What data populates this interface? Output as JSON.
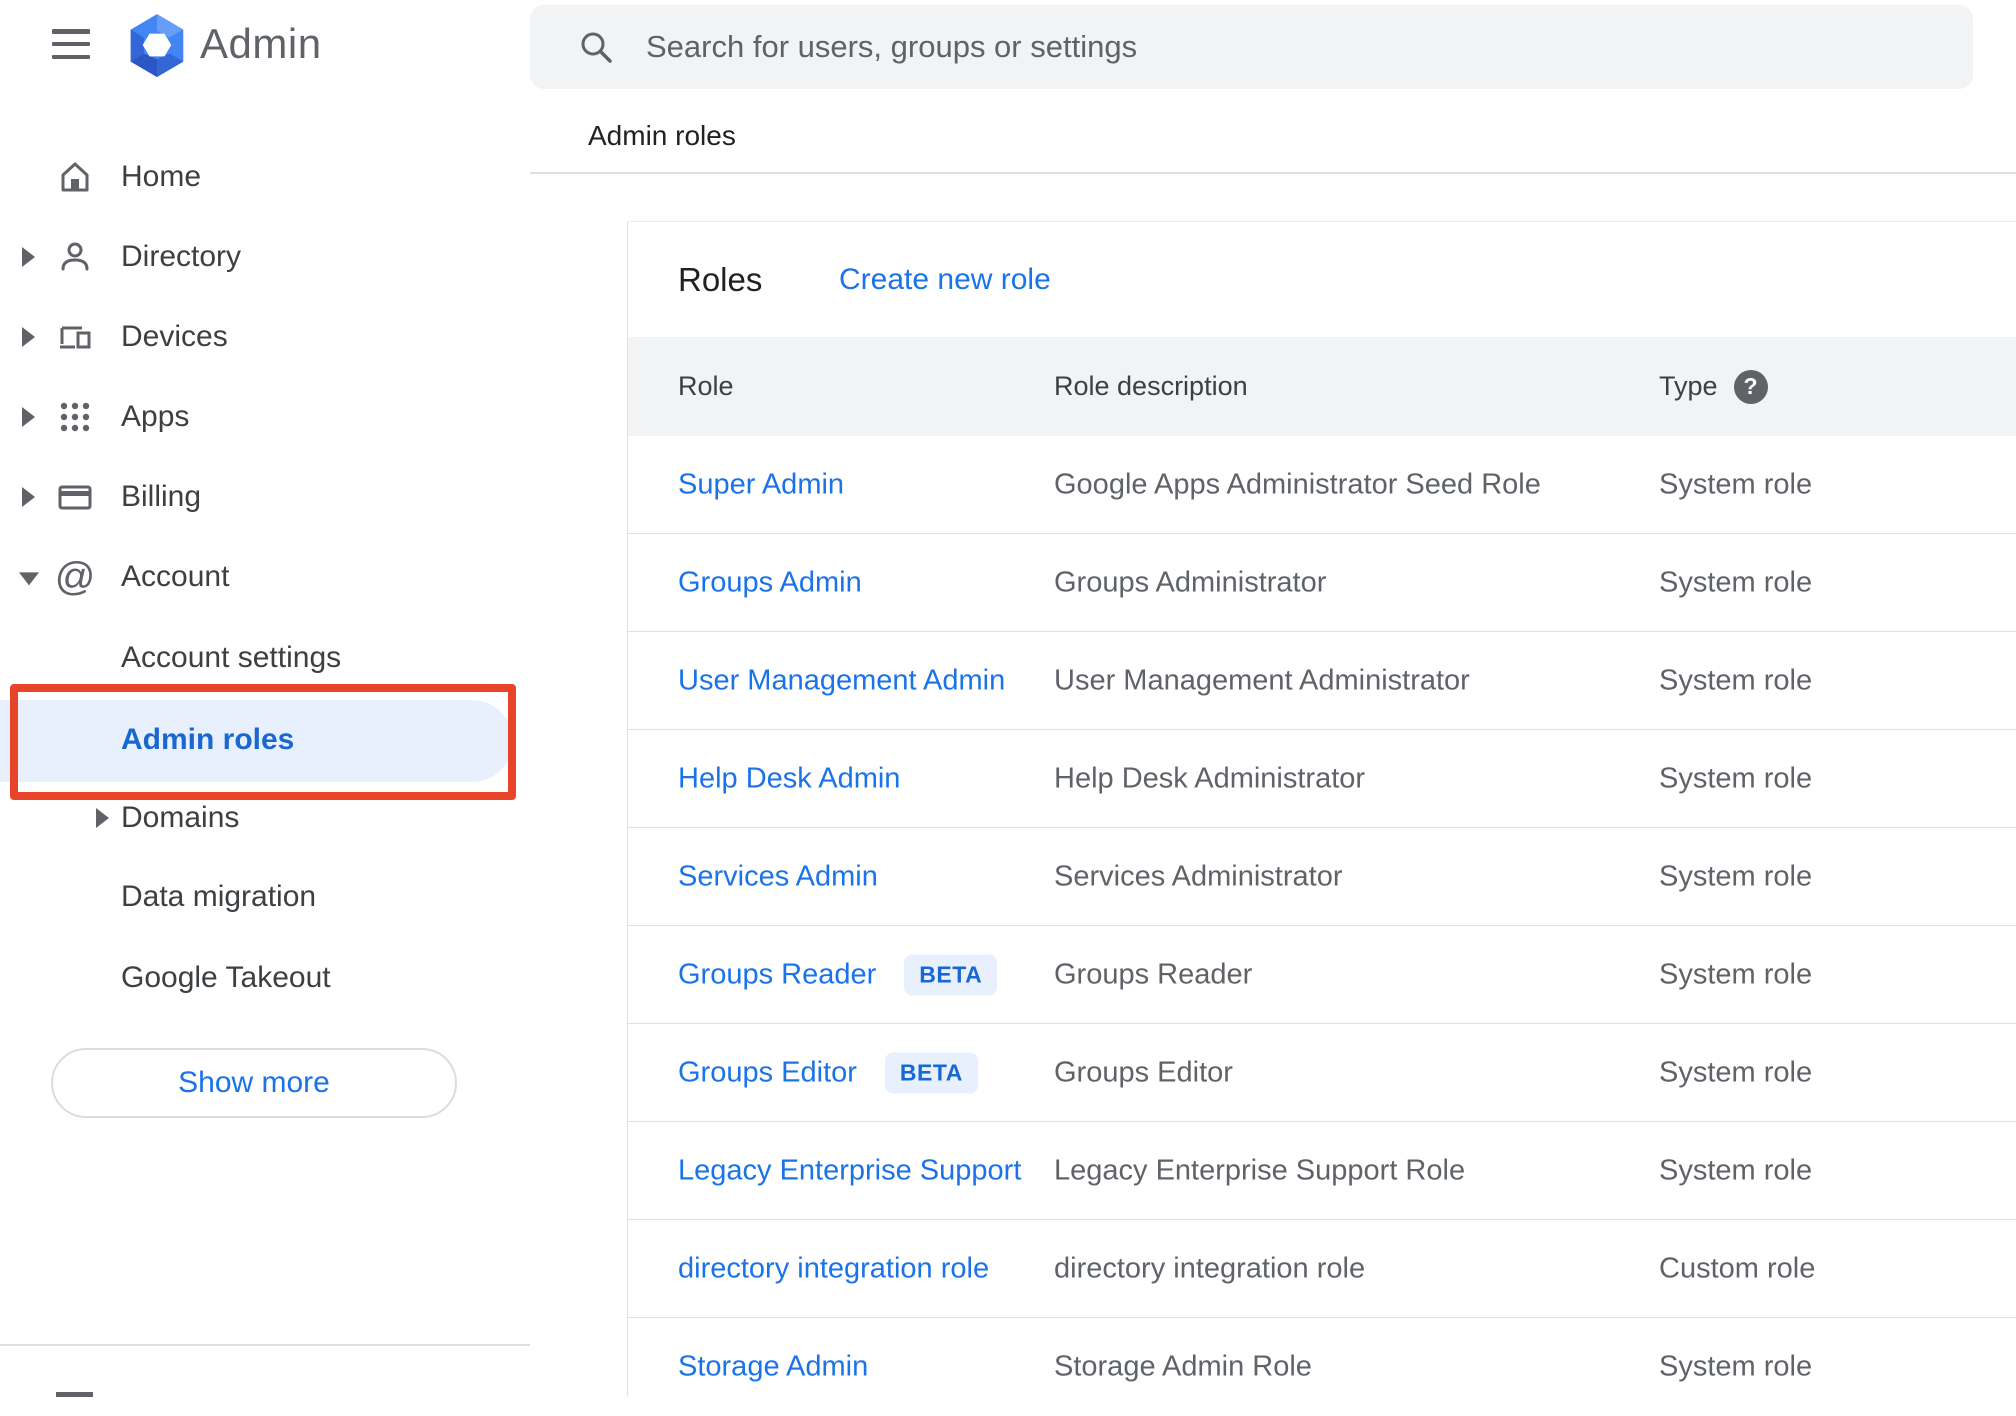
{
  "app": {
    "product_name": "Admin"
  },
  "search": {
    "placeholder": "Search for users, groups or settings"
  },
  "breadcrumb": "Admin roles",
  "sidebar": {
    "items": [
      {
        "label": "Home",
        "icon": "home",
        "caret": "none"
      },
      {
        "label": "Directory",
        "icon": "person",
        "caret": "right"
      },
      {
        "label": "Devices",
        "icon": "devices",
        "caret": "right"
      },
      {
        "label": "Apps",
        "icon": "apps-grid",
        "caret": "right"
      },
      {
        "label": "Billing",
        "icon": "credit-card",
        "caret": "right"
      },
      {
        "label": "Account",
        "icon": "at-sign",
        "caret": "down"
      },
      {
        "label": "Account settings",
        "icon": null,
        "caret": "none",
        "child": true
      },
      {
        "label": "Admin roles",
        "icon": null,
        "caret": "none",
        "child": true,
        "selected": true
      },
      {
        "label": "Domains",
        "icon": null,
        "caret": "right",
        "child": true
      },
      {
        "label": "Data migration",
        "icon": null,
        "caret": "none",
        "child": true
      },
      {
        "label": "Google Takeout",
        "icon": null,
        "caret": "none",
        "child": true
      }
    ],
    "show_more_label": "Show more"
  },
  "main": {
    "card_title": "Roles",
    "create_link": "Create new role",
    "table": {
      "columns": [
        "Role",
        "Role description",
        "Type"
      ],
      "rows": [
        {
          "role": "Super Admin",
          "description": "Google Apps Administrator Seed Role",
          "type": "System role"
        },
        {
          "role": "Groups Admin",
          "description": "Groups Administrator",
          "type": "System role"
        },
        {
          "role": "User Management Admin",
          "description": "User Management Administrator",
          "type": "System role"
        },
        {
          "role": "Help Desk Admin",
          "description": "Help Desk Administrator",
          "type": "System role"
        },
        {
          "role": "Services Admin",
          "description": "Services Administrator",
          "type": "System role"
        },
        {
          "role": "Groups Reader",
          "badge": "BETA",
          "description": "Groups Reader",
          "type": "System role"
        },
        {
          "role": "Groups Editor",
          "badge": "BETA",
          "description": "Groups Editor",
          "type": "System role"
        },
        {
          "role": "Legacy Enterprise Support",
          "description": "Legacy Enterprise Support Role",
          "type": "System role"
        },
        {
          "role": "directory integration role",
          "description": "directory integration role",
          "type": "Custom role"
        },
        {
          "role": "Storage Admin",
          "description": "Storage Admin Role",
          "type": "System role"
        }
      ]
    }
  },
  "annotation": {
    "highlighted_item": "Admin roles",
    "box_color": "#e8442a"
  },
  "colors": {
    "link_blue": "#1a73e8",
    "selected_blue": "#1967d2",
    "annotation_red": "#e8442a",
    "beta_badge_bg": "#e8f0fe",
    "table_header_bg": "#f1f3f4",
    "searchbar_bg": "#f1f3f4",
    "text_primary": "#202124",
    "text_secondary": "#5f6368",
    "divider": "#e0e0e0"
  }
}
